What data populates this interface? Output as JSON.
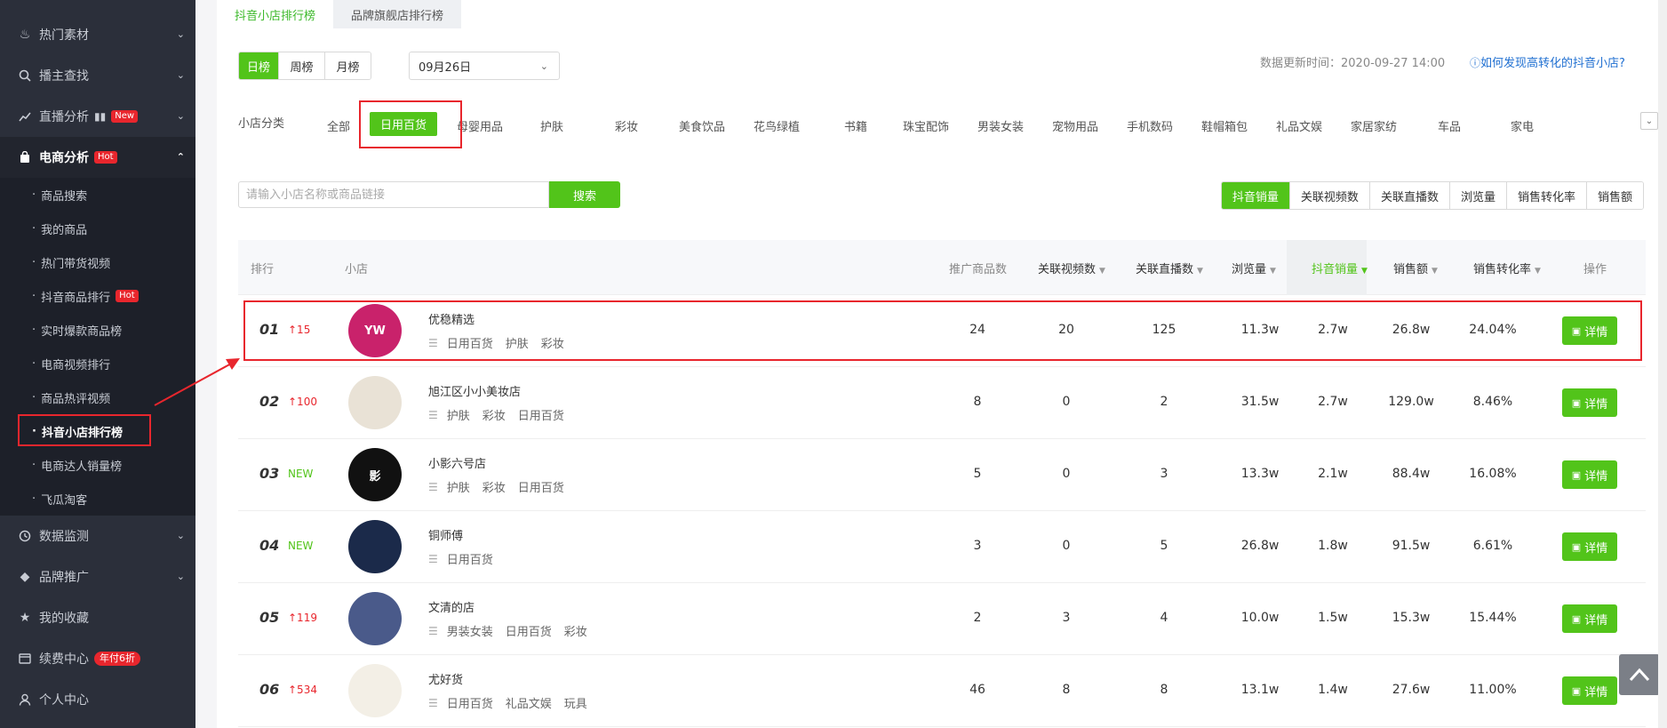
{
  "sidebar": {
    "items": [
      {
        "label": "热门素材",
        "icon": "fire-icon"
      },
      {
        "label": "播主查找",
        "icon": "search-icon"
      },
      {
        "label": "直播分析",
        "icon": "chart-icon",
        "badge": "New"
      },
      {
        "label": "电商分析",
        "icon": "shopping-bag-icon",
        "badge": "Hot"
      },
      {
        "label": "数据监测",
        "icon": "monitor-icon"
      },
      {
        "label": "品牌推广",
        "icon": "diamond-icon"
      },
      {
        "label": "我的收藏",
        "icon": "star-icon"
      },
      {
        "label": "续费中心",
        "icon": "card-icon",
        "badge": "年付6折"
      },
      {
        "label": "个人中心",
        "icon": "user-icon"
      }
    ],
    "sub_items": [
      {
        "label": "商品搜索"
      },
      {
        "label": "我的商品"
      },
      {
        "label": "热门带货视频"
      },
      {
        "label": "抖音商品排行",
        "badge": "Hot"
      },
      {
        "label": "实时爆款商品榜"
      },
      {
        "label": "电商视频排行"
      },
      {
        "label": "商品热评视频"
      },
      {
        "label": "抖音小店排行榜"
      },
      {
        "label": "电商达人销量榜"
      },
      {
        "label": "飞瓜淘客"
      }
    ]
  },
  "tabs": [
    "抖音小店排行榜",
    "品牌旗舰店排行榜"
  ],
  "period_buttons": [
    "日榜",
    "周榜",
    "月榜"
  ],
  "date_select": "09月26日",
  "update_time": "数据更新时间：2020-09-27 14:00",
  "help_link": "如何发现高转化的抖音小店?",
  "category_label": "小店分类",
  "categories": [
    "全部",
    "日用百货",
    "母婴用品",
    "护肤",
    "彩妆",
    "美食饮品",
    "花鸟绿植",
    "书籍",
    "珠宝配饰",
    "男装女装",
    "宠物用品",
    "手机数码",
    "鞋帽箱包",
    "礼品文娱",
    "家居家纺",
    "车品",
    "家电"
  ],
  "search": {
    "placeholder": "请输入小店名称或商品链接",
    "button": "搜索"
  },
  "sort_buttons": [
    "抖音销量",
    "关联视频数",
    "关联直播数",
    "浏览量",
    "销售转化率",
    "销售额"
  ],
  "table": {
    "headers": {
      "rank": "排行",
      "shop": "小店",
      "products": "推广商品数",
      "videos": "关联视频数",
      "lives": "关联直播数",
      "views": "浏览量",
      "douyin_sales": "抖音销量",
      "sales_amount": "销售额",
      "conversion": "销售转化率",
      "action": "操作"
    },
    "detail_label": "详情",
    "rows": [
      {
        "rank": "01",
        "change": "↑15",
        "change_type": "up",
        "name": "优稳精选",
        "tags": [
          "日用百货",
          "护肤",
          "彩妆"
        ],
        "products": "24",
        "videos": "20",
        "lives": "125",
        "views": "11.3w",
        "douyin_sales": "2.7w",
        "sales_amount": "26.8w",
        "conversion": "24.04%",
        "avatar_text": "YW",
        "avatar_color": "#c9226b"
      },
      {
        "rank": "02",
        "change": "↑100",
        "change_type": "up",
        "name": "旭江区小小美妆店",
        "tags": [
          "护肤",
          "彩妆",
          "日用百货"
        ],
        "products": "8",
        "videos": "0",
        "lives": "2",
        "views": "31.5w",
        "douyin_sales": "2.7w",
        "sales_amount": "129.0w",
        "conversion": "8.46%",
        "avatar_text": "",
        "avatar_color": "#e9e2d6"
      },
      {
        "rank": "03",
        "change": "NEW",
        "change_type": "new",
        "name": "小影六号店",
        "tags": [
          "护肤",
          "彩妆",
          "日用百货"
        ],
        "products": "5",
        "videos": "0",
        "lives": "3",
        "views": "13.3w",
        "douyin_sales": "2.1w",
        "sales_amount": "88.4w",
        "conversion": "16.08%",
        "avatar_text": "影",
        "avatar_color": "#111111"
      },
      {
        "rank": "04",
        "change": "NEW",
        "change_type": "new",
        "name": "铜师傅",
        "tags": [
          "日用百货"
        ],
        "products": "3",
        "videos": "0",
        "lives": "5",
        "views": "26.8w",
        "douyin_sales": "1.8w",
        "sales_amount": "91.5w",
        "conversion": "6.61%",
        "avatar_text": "",
        "avatar_color": "#1b2a4a"
      },
      {
        "rank": "05",
        "change": "↑119",
        "change_type": "up",
        "name": "文清的店",
        "tags": [
          "男装女装",
          "日用百货",
          "彩妆"
        ],
        "products": "2",
        "videos": "3",
        "lives": "4",
        "views": "10.0w",
        "douyin_sales": "1.5w",
        "sales_amount": "15.3w",
        "conversion": "15.44%",
        "avatar_text": "",
        "avatar_color": "#4a5a8a"
      },
      {
        "rank": "06",
        "change": "↑534",
        "change_type": "up",
        "name": "尤好货",
        "tags": [
          "日用百货",
          "礼品文娱",
          "玩具"
        ],
        "products": "46",
        "videos": "8",
        "lives": "8",
        "views": "13.1w",
        "douyin_sales": "1.4w",
        "sales_amount": "27.6w",
        "conversion": "11.00%",
        "avatar_text": "",
        "avatar_color": "#f3efe6"
      }
    ]
  },
  "colors": {
    "accent": "#52c41a",
    "highlight": "#e8262d",
    "sidebar": "#2b2f3a",
    "link": "#1f6fd1"
  }
}
